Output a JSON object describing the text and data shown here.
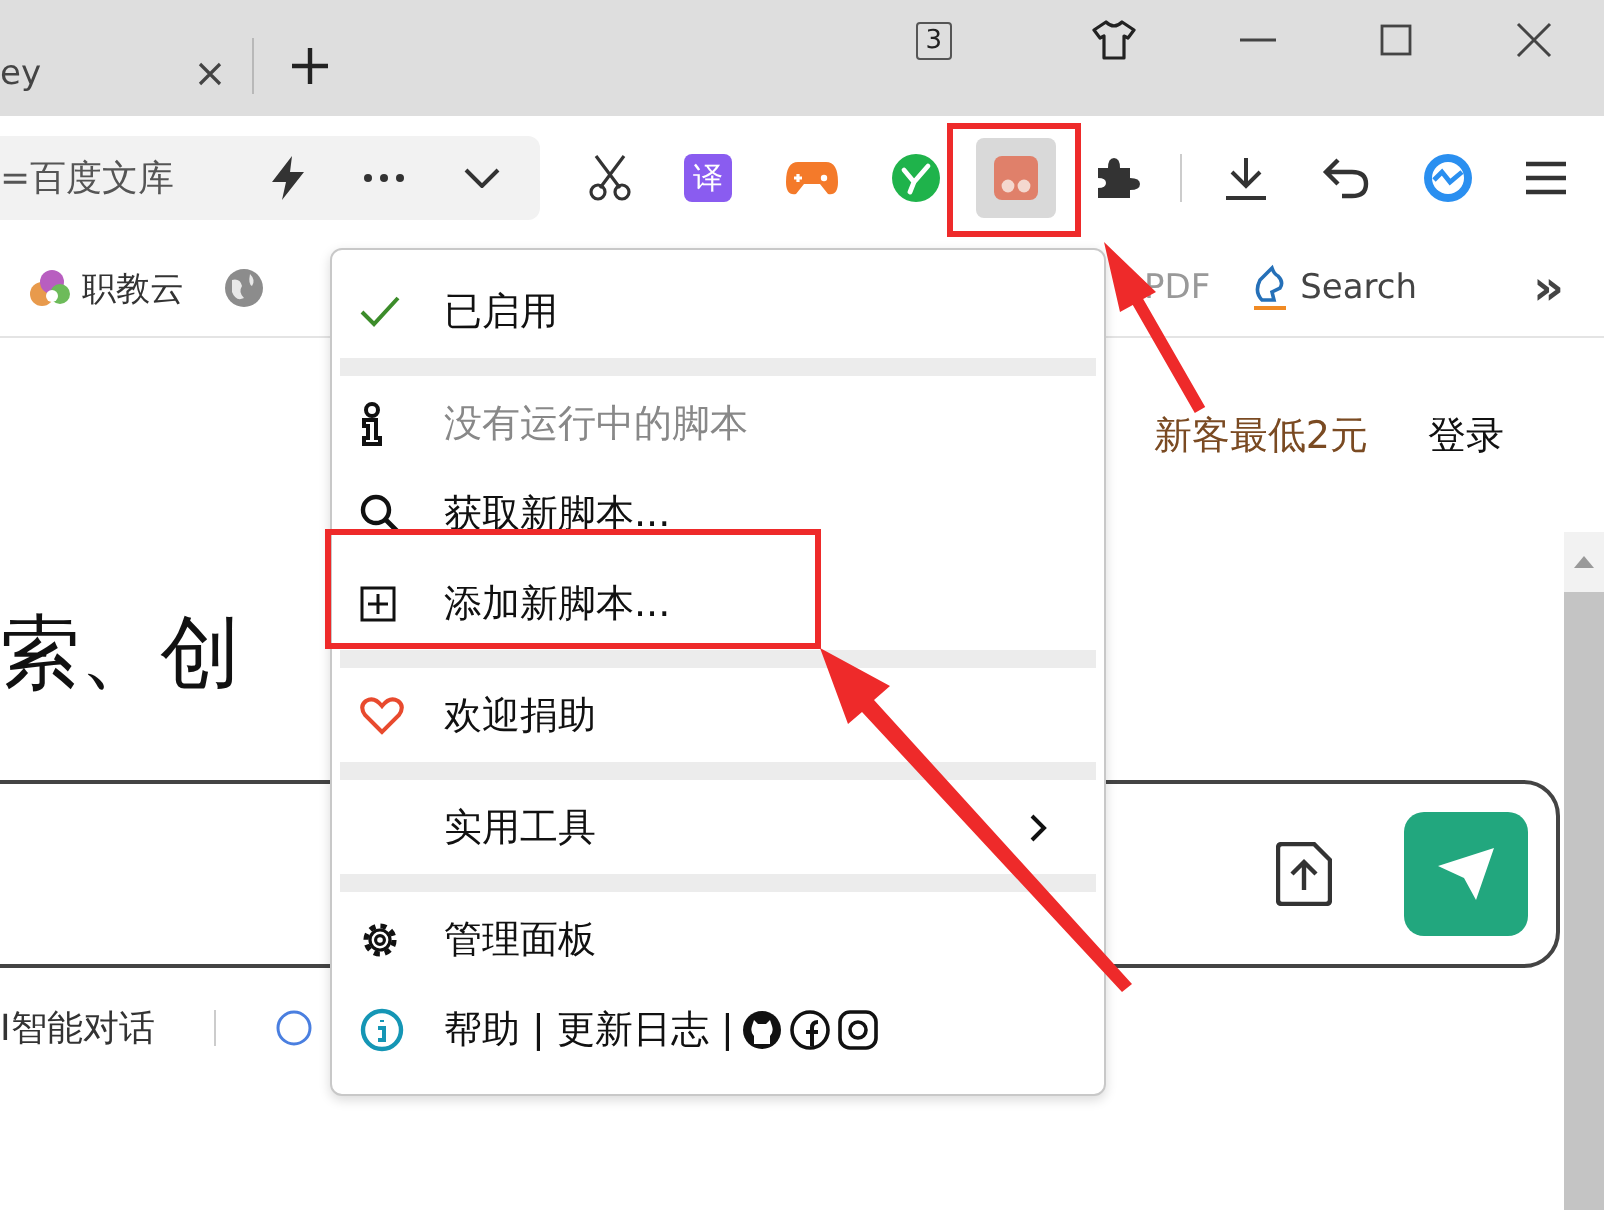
{
  "tabs": [
    {
      "label": "ey",
      "selected": true
    }
  ],
  "window_controls": {
    "tab_count": "3"
  },
  "address_bar": {
    "value": "=百度文库"
  },
  "toolbar": {
    "translate_label": "译"
  },
  "bookmarks": [
    {
      "label": "职教云",
      "kind": "cloud"
    },
    {
      "kind": "globe"
    },
    {
      "label": "PDF",
      "kind": "plain"
    },
    {
      "label": "Search",
      "kind": "search"
    }
  ],
  "bookmarks_more": "»",
  "page": {
    "promo": "新客最低2元",
    "login": "登录",
    "heading": "索、创",
    "bottom_link": "I智能对话"
  },
  "menu": {
    "sections": [
      [
        {
          "kind": "enabled",
          "label": "已启用",
          "checked": true,
          "disabled": false
        }
      ],
      [
        {
          "kind": "status",
          "label": "没有运行中的脚本",
          "disabled": true
        },
        {
          "kind": "find",
          "label": "获取新脚本...",
          "disabled": false
        },
        {
          "kind": "add",
          "label": "添加新脚本...",
          "disabled": false
        }
      ],
      [
        {
          "kind": "donate",
          "label": "欢迎捐助",
          "disabled": false
        }
      ],
      [
        {
          "kind": "submenu",
          "label": "实用工具",
          "disabled": false
        }
      ],
      [
        {
          "kind": "dashboard",
          "label": "管理面板",
          "disabled": false
        },
        {
          "kind": "help",
          "label": "帮助 | 更新日志 |",
          "disabled": false
        }
      ]
    ]
  }
}
